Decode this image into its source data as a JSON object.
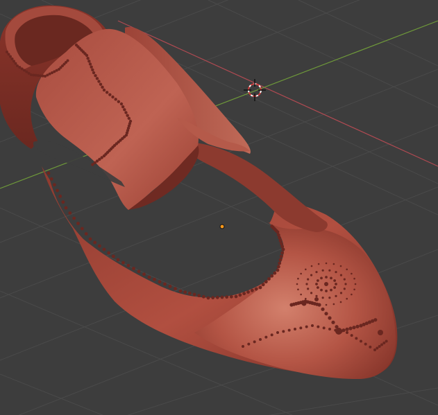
{
  "app": {
    "name": "3D viewport",
    "mode": "sculpt"
  },
  "viewport": {
    "background": "#3d3d3d",
    "grid_color": "#4a4a4a",
    "x_axis_color": "#b04a52",
    "y_axis_color": "#6f9a3a"
  },
  "scene": {
    "object": "shoe-mesh",
    "material_color": "#a9493c",
    "material_shadow": "#6e2a22",
    "material_highlight": "#d07a68",
    "cursor_icon": "3d-cursor-icon",
    "origin_icon": "object-origin-icon",
    "origin_color": "#ff9a1a"
  }
}
